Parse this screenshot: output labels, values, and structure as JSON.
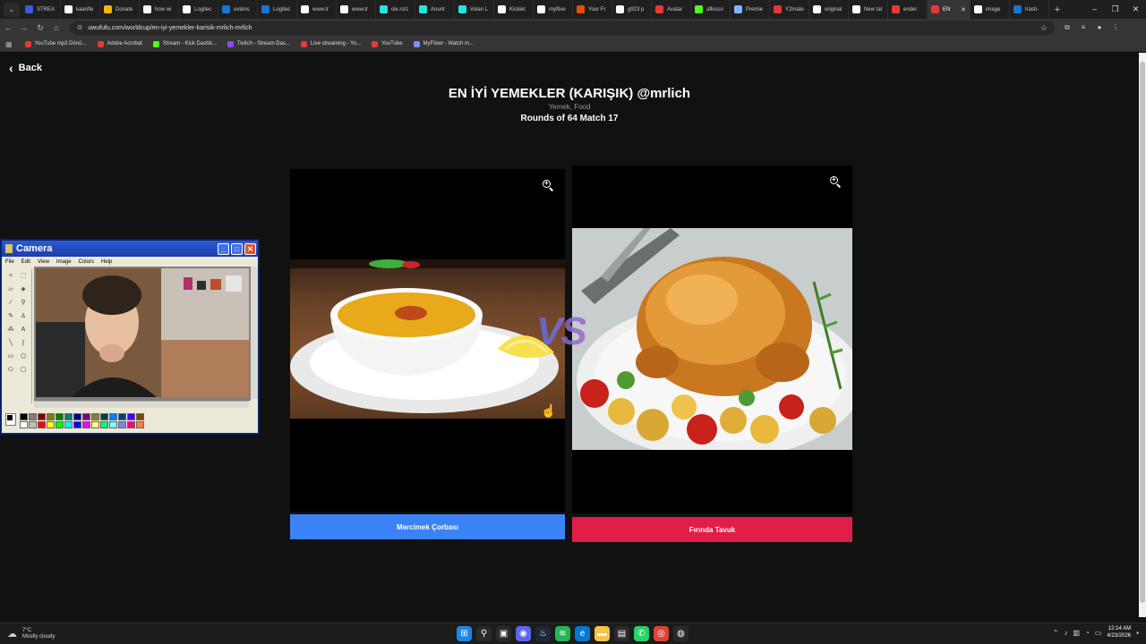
{
  "browser": {
    "tabs": [
      {
        "title": "STREA",
        "color": "#3b5bdb"
      },
      {
        "title": "kaanfle",
        "color": "#ffffff"
      },
      {
        "title": "Donate",
        "color": "#f2b705"
      },
      {
        "title": "how wi",
        "color": "#ffffff"
      },
      {
        "title": "Logitec",
        "color": "#ffffff"
      },
      {
        "title": "extens",
        "color": "#1976d2"
      },
      {
        "title": "Logitec",
        "color": "#1976d2"
      },
      {
        "title": "www.tr",
        "color": "#ffffff"
      },
      {
        "title": "www.tr",
        "color": "#ffffff"
      },
      {
        "title": "olx.ro/z",
        "color": "#23e5db"
      },
      {
        "title": "Anunt",
        "color": "#23e5db"
      },
      {
        "title": "Volan L",
        "color": "#23e5db"
      },
      {
        "title": "Kicklet",
        "color": "#ffffff"
      },
      {
        "title": "myflixe",
        "color": "#ffffff"
      },
      {
        "title": "Your Fr",
        "color": "#e65100"
      },
      {
        "title": "g923 p",
        "color": "#ffffff"
      },
      {
        "title": "Avatar",
        "color": "#e53935"
      },
      {
        "title": "afkisco",
        "color": "#53fc18"
      },
      {
        "title": "Premie",
        "color": "#7fb3ff"
      },
      {
        "title": "Y2mate",
        "color": "#e53935"
      },
      {
        "title": "original",
        "color": "#ffffff"
      },
      {
        "title": "New tal",
        "color": "#ffffff"
      },
      {
        "title": "ender",
        "color": "#e53935"
      },
      {
        "title": "EN",
        "color": "#e53935",
        "active": true
      },
      {
        "title": "image",
        "color": "#ffffff"
      },
      {
        "title": "trash-",
        "color": "#1976d2"
      }
    ],
    "url": "uwufufu.com/worldcup/en-iyi-yemekler-karisik-mrlich-mrlich",
    "bookmarks": [
      {
        "label": "YouTube mp3 Dönü...",
        "color": "#e53935"
      },
      {
        "label": "Adobe Acrobat",
        "color": "#e53935"
      },
      {
        "label": "Stream - Kick Dashb...",
        "color": "#53fc18"
      },
      {
        "label": "Twitch - Stream Das...",
        "color": "#9146ff"
      },
      {
        "label": "Live streaming - Yo...",
        "color": "#e53935"
      },
      {
        "label": "YouTube",
        "color": "#e53935"
      },
      {
        "label": "MyFlixer - Watch m...",
        "color": "#7c8cff"
      }
    ]
  },
  "page": {
    "back_label": "Back",
    "title": "EN İYİ YEMEKLER (KARIŞIK) @mrlich",
    "subtitle": "Yemek, Food",
    "round": "Rounds of 64 Match 17",
    "vs": "VS",
    "left_choice": "Mercimek Çorbası",
    "right_choice": "Fırında Tavuk",
    "left_color": "#3b82f6",
    "right_color": "#e11d48"
  },
  "paint": {
    "title": "Camera",
    "menu": [
      "File",
      "Edit",
      "View",
      "Image",
      "Colors",
      "Help"
    ]
  },
  "taskbar": {
    "temp": "7°C",
    "weather": "Mostly cloudy",
    "time": "12:14 AM",
    "date": "4/23/2026"
  }
}
